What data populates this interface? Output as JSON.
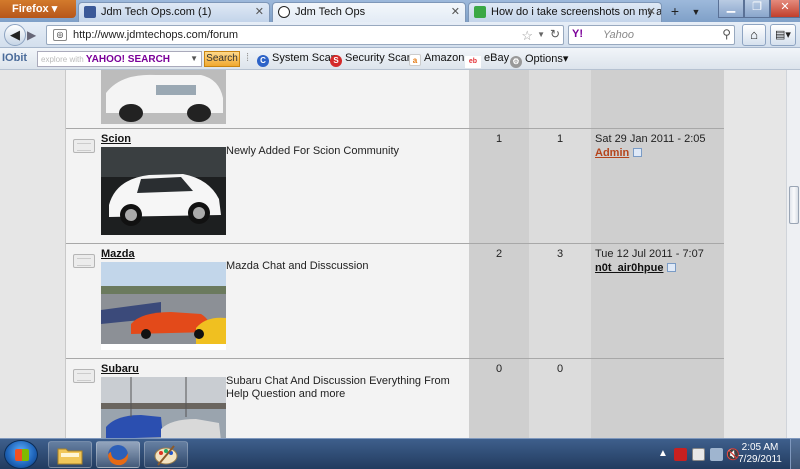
{
  "browser": {
    "app_button": "Firefox",
    "tabs": [
      {
        "label": "Jdm Tech Ops.com (1)",
        "active": false,
        "icon": "facebook-icon"
      },
      {
        "label": "Jdm Tech Ops",
        "active": true,
        "icon": "site-icon"
      },
      {
        "label": "How do i take screenshots on my ace...",
        "active": false,
        "icon": "answers-icon"
      }
    ],
    "url": "http://www.jdmtechops.com/forum",
    "search_placeholder": "Yahoo",
    "search_engine_logo": "Y!"
  },
  "toolbar": {
    "brand": "IObit",
    "search_placeholder_prefix": "explore with",
    "search_placeholder_brand": "YAHOO! SEARCH",
    "search_button": "Search",
    "items": [
      "System Scan",
      "Security Scan",
      "Amazon",
      "eBay",
      "Options"
    ]
  },
  "forum": {
    "rows": [
      {
        "name": "",
        "description": "",
        "topics": "",
        "posts": "",
        "last_date": "",
        "last_user": ""
      },
      {
        "name": "Scion",
        "description": "Newly Added For Scion Community",
        "topics": "1",
        "posts": "1",
        "last_date": "Sat 29 Jan 2011 - 2:05",
        "last_user": "Admin",
        "last_user_color": "#b5441b"
      },
      {
        "name": "Mazda",
        "description": "Mazda Chat and Disscussion",
        "topics": "2",
        "posts": "3",
        "last_date": "Tue 12 Jul 2011 - 7:07",
        "last_user": "n0t_air0hpue",
        "last_user_color": "#111111"
      },
      {
        "name": "Subaru",
        "description": "Subaru Chat And Discussion Everything From Help Question and more",
        "topics": "0",
        "posts": "0",
        "last_date": "",
        "last_user": ""
      }
    ]
  },
  "taskbar": {
    "clock_time": "2:05 AM",
    "clock_date": "7/29/2011"
  },
  "colors": {
    "accent": "#b5441b",
    "taskbar": "#2a4670"
  }
}
